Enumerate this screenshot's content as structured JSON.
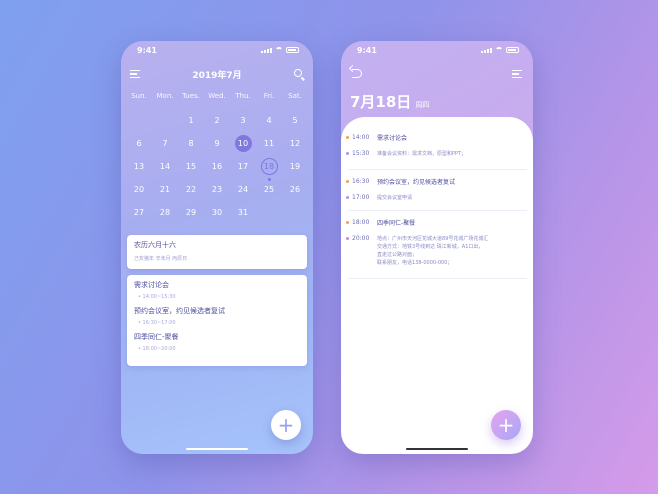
{
  "left_phone": {
    "status_time": "9:41",
    "header_title": "2019年7月",
    "weekdays": [
      "Sun.",
      "Mon.",
      "Tues.",
      "Wed.",
      "Thu.",
      "Fri.",
      "Sat."
    ],
    "days": [
      "",
      "",
      "1",
      "2",
      "3",
      "4",
      "5",
      "6",
      "7",
      "8",
      "9",
      "10",
      "11",
      "12",
      "13",
      "14",
      "15",
      "16",
      "17",
      "18",
      "19",
      "20",
      "21",
      "22",
      "23",
      "24",
      "25",
      "26",
      "27",
      "28",
      "29",
      "30",
      "31"
    ],
    "selected_day": "10",
    "today_day": "18",
    "lunar_card": {
      "title": "农历六月十六",
      "subtitle": "己亥猪年 辛未月 丙辰日"
    },
    "events": [
      {
        "title": "需求讨论会",
        "time": "14:00~15:30"
      },
      {
        "title": "预约会议室，约见候选者复试",
        "time": "16:30~17:00"
      },
      {
        "title": "四季同仁-聚餐",
        "time": "18:00~20:00"
      }
    ],
    "fab": "+"
  },
  "right_phone": {
    "status_time": "9:41",
    "date": "7月18日",
    "weekday": "周四",
    "schedule": [
      {
        "time": "14:00",
        "text": "需求讨论会",
        "dot": "orange"
      },
      {
        "time": "15:30",
        "text": "准备会议资料：需求文档，原型和PPT；",
        "dot": "purple"
      },
      {
        "time": "16:30",
        "text": "预约会议室，约见候选者复试",
        "dot": "orange"
      },
      {
        "time": "17:00",
        "text": "提交会议室申请",
        "dot": "purple"
      },
      {
        "time": "18:00",
        "text": "四季同仁-聚餐",
        "dot": "orange"
      },
      {
        "time": "20:00",
        "text": "地点：广州市天河区花城大道89号花城广场花城汇",
        "dot": "purple"
      }
    ],
    "detail_lines": [
      "交通方式：地铁3号线到达 珠江新城，A1口出，",
      "直走过公路对面；",
      "联系朋友，电话138-0000-000；"
    ],
    "fab": "+"
  },
  "colors": {
    "accent": "#7f78dd",
    "text_dark": "#4d4e9e",
    "orange_dot": "#f0a24b",
    "purple_dot": "#c289ec"
  }
}
